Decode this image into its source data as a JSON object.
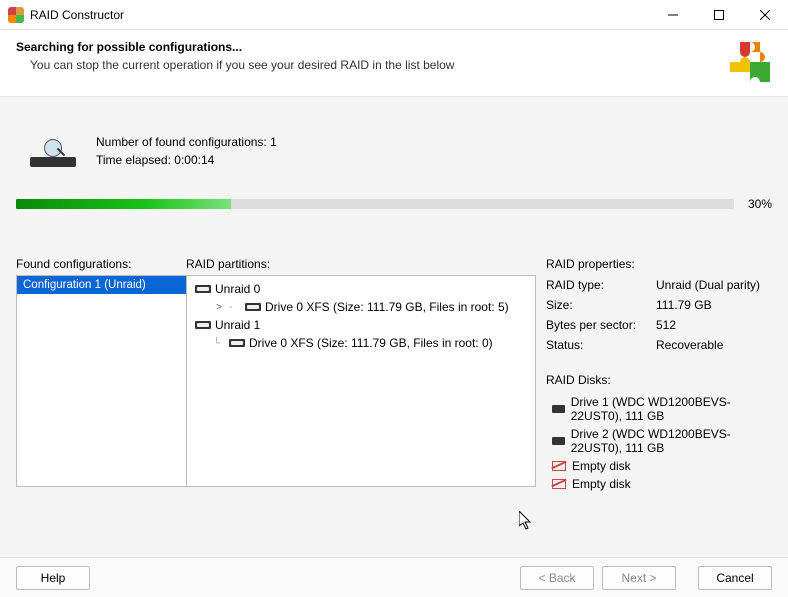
{
  "window": {
    "title": "RAID Constructor"
  },
  "header": {
    "title": "Searching for possible configurations...",
    "subtitle": "You can stop the current operation if you see your desired RAID in the list below"
  },
  "status": {
    "found_label": "Number of found configurations:",
    "found_count": "1",
    "elapsed_label": "Time elapsed:",
    "elapsed": "0:00:14"
  },
  "progress": {
    "percent": 30,
    "percent_text": "30%"
  },
  "labels": {
    "found": "Found configurations:",
    "partitions": "RAID partitions:",
    "properties": "RAID properties:",
    "disks": "RAID Disks:"
  },
  "found_list": [
    {
      "label": "Configuration 1 (Unraid)"
    }
  ],
  "tree": [
    {
      "level": 0,
      "icon": "drive",
      "label": "Unraid 0",
      "expandable": false
    },
    {
      "level": 1,
      "icon": "drive",
      "label": "Drive 0 XFS (Size: 111.79 GB, Files in root: 5)",
      "chevron": ">",
      "connector": "-"
    },
    {
      "level": 0,
      "icon": "drive",
      "label": "Unraid 1",
      "expandable": false
    },
    {
      "level": 1,
      "icon": "drive",
      "label": "Drive 0 XFS (Size: 111.79 GB, Files in root: 0)",
      "connector": "└"
    }
  ],
  "props": {
    "raid_type": {
      "label": "RAID type:",
      "value": "Unraid (Dual parity)"
    },
    "size": {
      "label": "Size:",
      "value": "111.79 GB"
    },
    "bps": {
      "label": "Bytes per sector:",
      "value": "512"
    },
    "status": {
      "label": "Status:",
      "value": "Recoverable"
    }
  },
  "disks": [
    {
      "icon": "drive",
      "label": "Drive 1 (WDC WD1200BEVS-22UST0), 111 GB"
    },
    {
      "icon": "drive",
      "label": "Drive 2 (WDC WD1200BEVS-22UST0), 111 GB"
    },
    {
      "icon": "empty",
      "label": "Empty disk"
    },
    {
      "icon": "empty",
      "label": "Empty disk"
    }
  ],
  "buttons": {
    "help": "Help",
    "back": "< Back",
    "next": "Next >",
    "cancel": "Cancel"
  }
}
